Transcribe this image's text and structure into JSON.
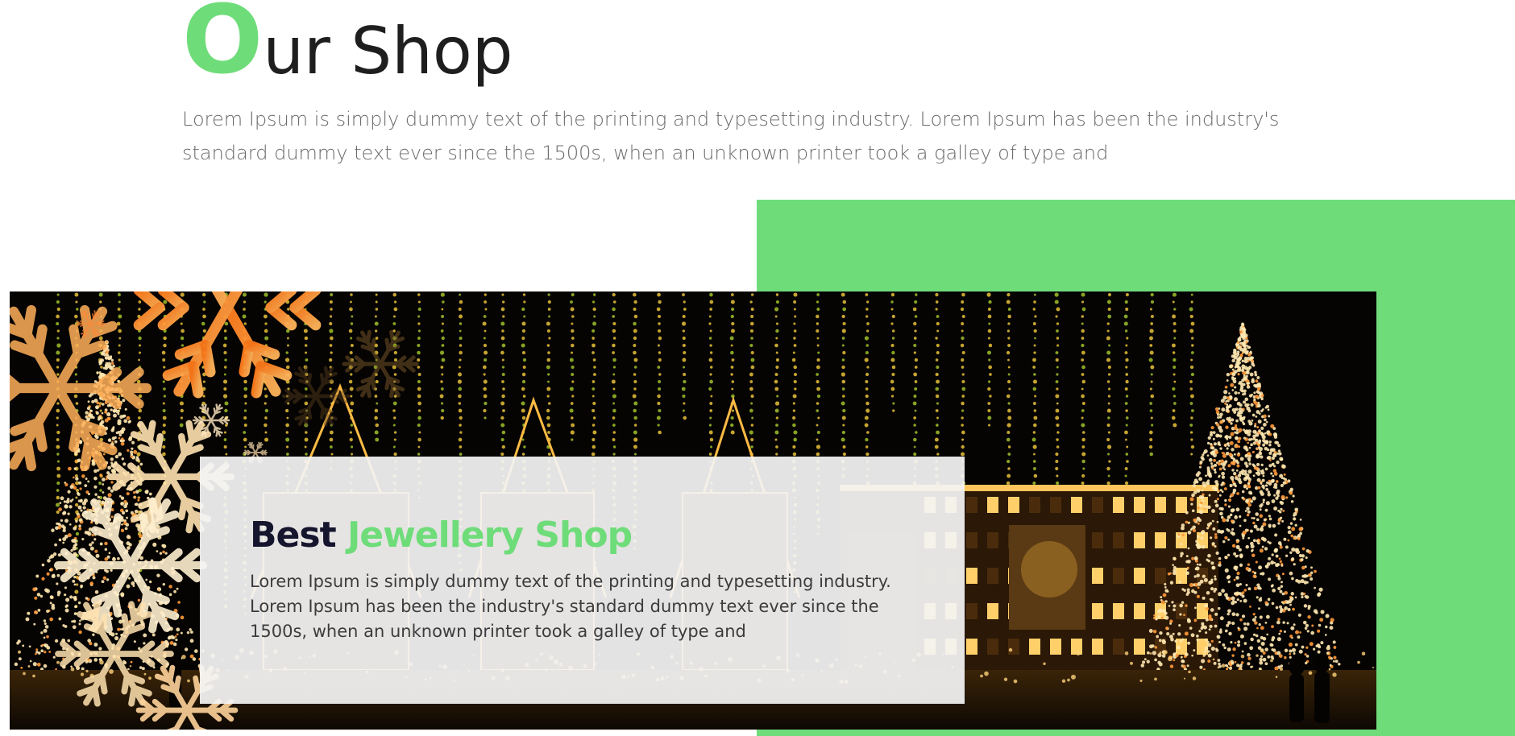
{
  "header": {
    "title_first_letter": "O",
    "title_rest": "ur Shop",
    "intro": "Lorem Ipsum is simply dummy text of the printing and typesetting industry. Lorem Ipsum has been the industry's standard dummy text ever since the 1500s, when an unknown printer took a galley of type and"
  },
  "feature": {
    "title_dark": "Best",
    "title_green": "Jewellery Shop",
    "body": "Lorem Ipsum is simply dummy text of the printing and typesetting industry. Lorem Ipsum has been the industry's standard dummy text ever since the 1500s, when an unknown printer took a galley of type and",
    "image_icon": "christmas-market-night-photo"
  },
  "colors": {
    "accent": "#6fdc7a",
    "heading_dark": "#15152e",
    "body_text": "#6b6b6b"
  }
}
